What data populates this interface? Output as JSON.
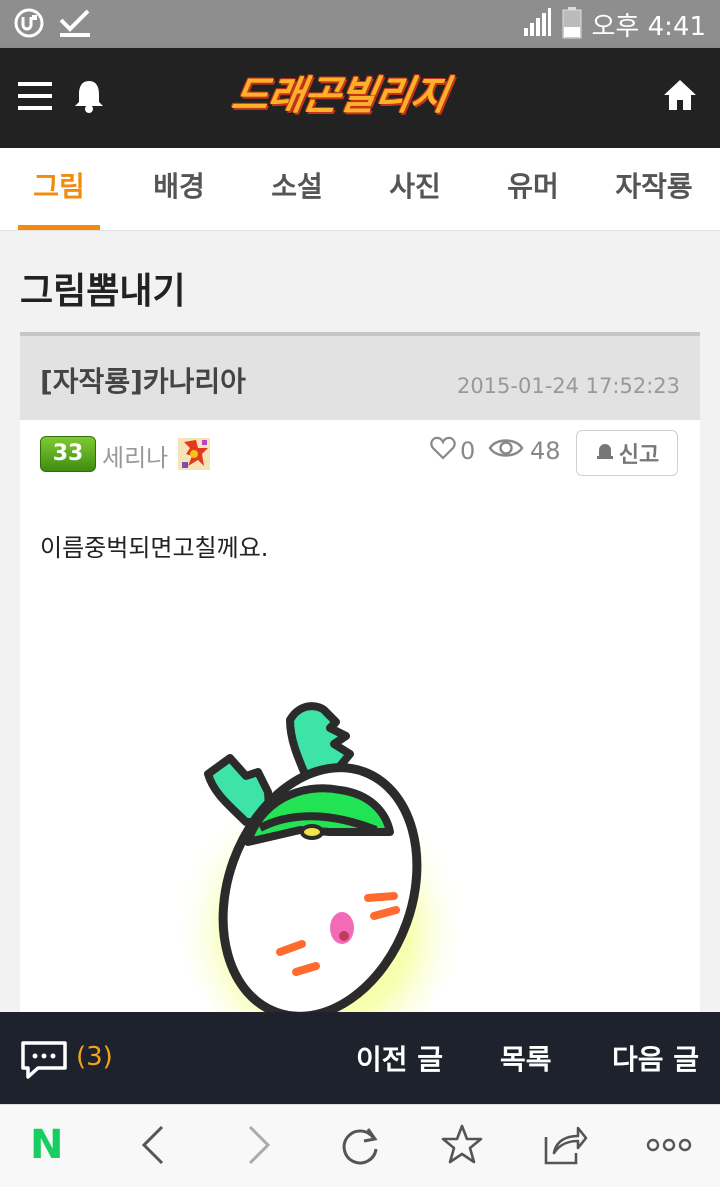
{
  "status_bar": {
    "time": "오후 4:41",
    "icons": [
      "app-icon",
      "download-check-icon",
      "signal-icon",
      "battery-icon"
    ]
  },
  "app_bar": {
    "logo_text": "드래곤빌리지",
    "icons": [
      "menu-icon",
      "bell-icon",
      "home-icon"
    ]
  },
  "tabs": [
    {
      "label": "그림",
      "active": true
    },
    {
      "label": "배경",
      "active": false
    },
    {
      "label": "소설",
      "active": false
    },
    {
      "label": "사진",
      "active": false
    },
    {
      "label": "유머",
      "active": false
    },
    {
      "label": "자작룡",
      "active": false
    }
  ],
  "section_title": "그림뽐내기",
  "post": {
    "title": "[자작룡]카나리아",
    "date": "2015-01-24 17:52:23",
    "author_level": "33",
    "author": "세리나",
    "likes": "0",
    "views": "48",
    "report_label": "신고",
    "body": "이름중벅되면고칠께요."
  },
  "bottom_bar": {
    "comment_count": "(3)",
    "prev_label": "이전 글",
    "list_label": "목록",
    "next_label": "다음 글"
  },
  "browser_bar": {
    "home_logo": "N",
    "icons": [
      "back-icon",
      "forward-icon",
      "refresh-icon",
      "star-icon",
      "share-icon",
      "more-icon"
    ]
  },
  "colors": {
    "accent": "#f38a0b",
    "app_bar": "#222222",
    "bottom_bar": "#1d222c",
    "naver_green": "#19ce60"
  }
}
